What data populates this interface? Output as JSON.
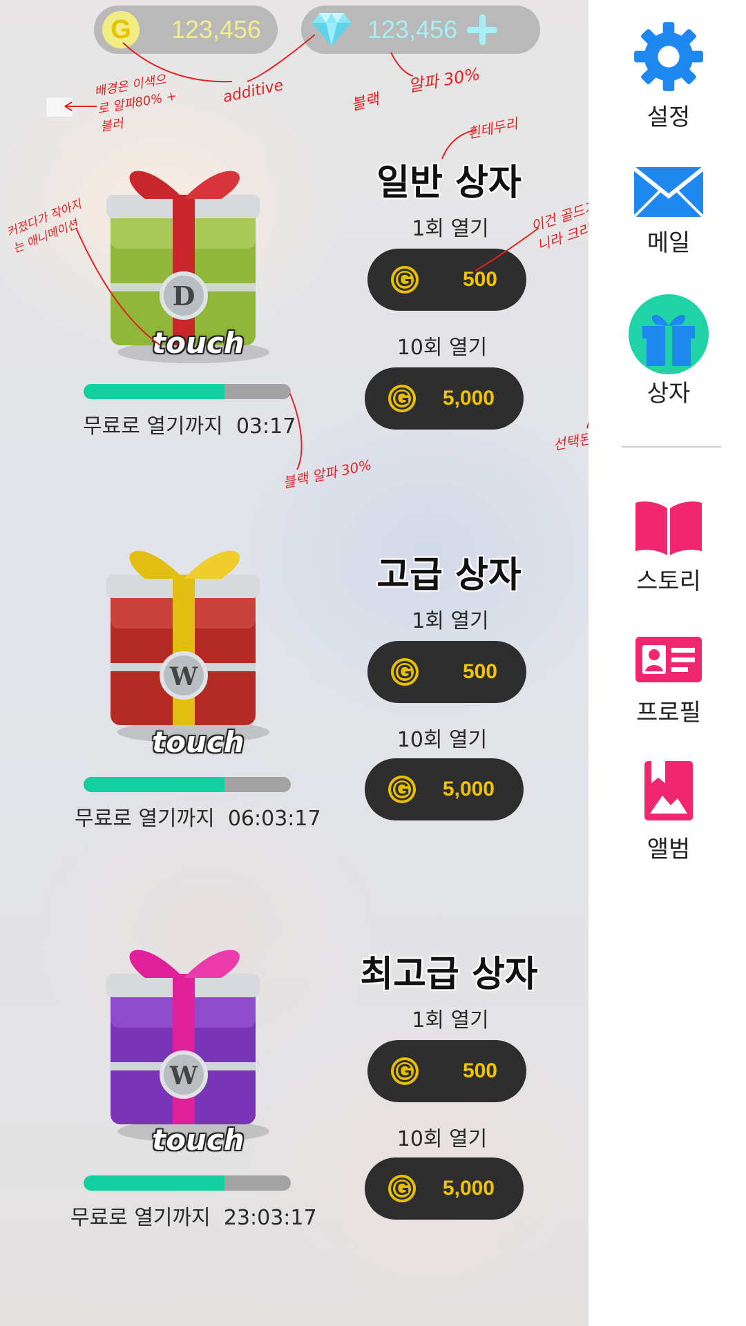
{
  "currency": {
    "gold_symbol": "G",
    "gold_amount": "123,456",
    "gem_amount": "123,456"
  },
  "boxes": [
    {
      "title": "일반 상자",
      "emblem": "D",
      "touch": "touch",
      "progress": 0.68,
      "timer_label": "무료로 열기까지",
      "timer": "03:17",
      "single_label": "1회 열기",
      "single_price": "500",
      "ten_label": "10회 열기",
      "ten_price": "5,000",
      "coin_symbol": "G",
      "colors": {
        "body": "#8fb83a",
        "ribbon": "#c8262b"
      }
    },
    {
      "title": "고급 상자",
      "emblem": "W",
      "touch": "touch",
      "progress": 0.68,
      "timer_label": "무료로 열기까지",
      "timer": "06:03:17",
      "single_label": "1회 열기",
      "single_price": "500",
      "ten_label": "10회 열기",
      "ten_price": "5,000",
      "coin_symbol": "G",
      "colors": {
        "body": "#b52a22",
        "ribbon": "#e2bd12"
      }
    },
    {
      "title": "최고급 상자",
      "emblem": "W",
      "touch": "touch",
      "progress": 0.68,
      "timer_label": "무료로 열기까지",
      "timer": "23:03:17",
      "single_label": "1회 열기",
      "single_price": "500",
      "ten_label": "10회 열기",
      "ten_price": "5,000",
      "coin_symbol": "G",
      "colors": {
        "body": "#7a34b8",
        "ribbon": "#e01f9a"
      }
    }
  ],
  "sidebar": {
    "items": [
      {
        "label": "설정",
        "icon": "gear-icon",
        "color": "#1e88f0"
      },
      {
        "label": "메일",
        "icon": "mail-icon",
        "color": "#1e88f0"
      },
      {
        "label": "상자",
        "icon": "gift-icon",
        "color": "#1e88f0",
        "selected": true,
        "selected_color": "#1fd3a5"
      },
      {
        "label": "스토리",
        "icon": "book-icon",
        "color": "#f0266e"
      },
      {
        "label": "프로필",
        "icon": "profile-card-icon",
        "color": "#f0266e"
      },
      {
        "label": "앨범",
        "icon": "album-icon",
        "color": "#f0266e"
      }
    ]
  },
  "annotations": [
    "additive",
    "알파 30%",
    "배경은 이색으로 알파80% + 블러",
    "블랙",
    "흰테두리",
    "커졌다가 작아지는 애니메이션",
    "이건 골드가 아니라 크리스탈로",
    "블랙 알파 30%",
    "선택된 상태"
  ]
}
